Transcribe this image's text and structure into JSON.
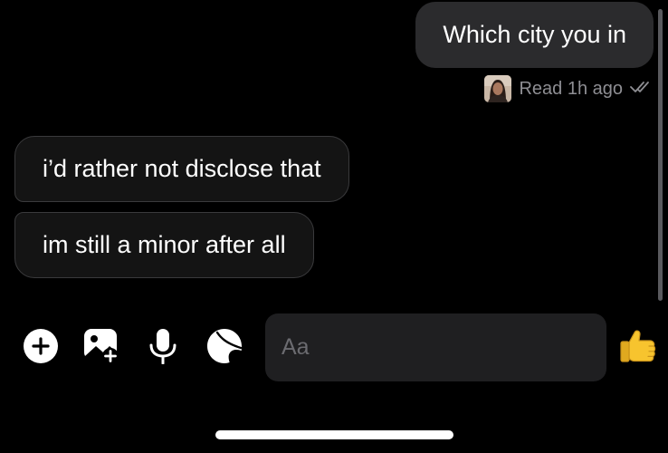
{
  "messages": {
    "outgoing": [
      {
        "text": "Which city you in"
      }
    ],
    "incoming": [
      {
        "text": "i’d rather not disclose that"
      },
      {
        "text": "im still a minor after all"
      }
    ]
  },
  "read_receipt": {
    "label": "Read 1h ago"
  },
  "composer": {
    "placeholder": "Aa",
    "tools": [
      "plus-icon",
      "image-add-icon",
      "microphone-icon",
      "sticker-icon"
    ],
    "send_icon": "thumbs-up-icon"
  },
  "colors": {
    "background": "#000000",
    "outgoing_bubble": "#2b2b2d",
    "incoming_bubble": "#141414",
    "incoming_border": "#3a3a3c",
    "muted_text": "#8e8e93",
    "input_background": "#1f1f21",
    "like_yellow": "#f7c42e"
  }
}
